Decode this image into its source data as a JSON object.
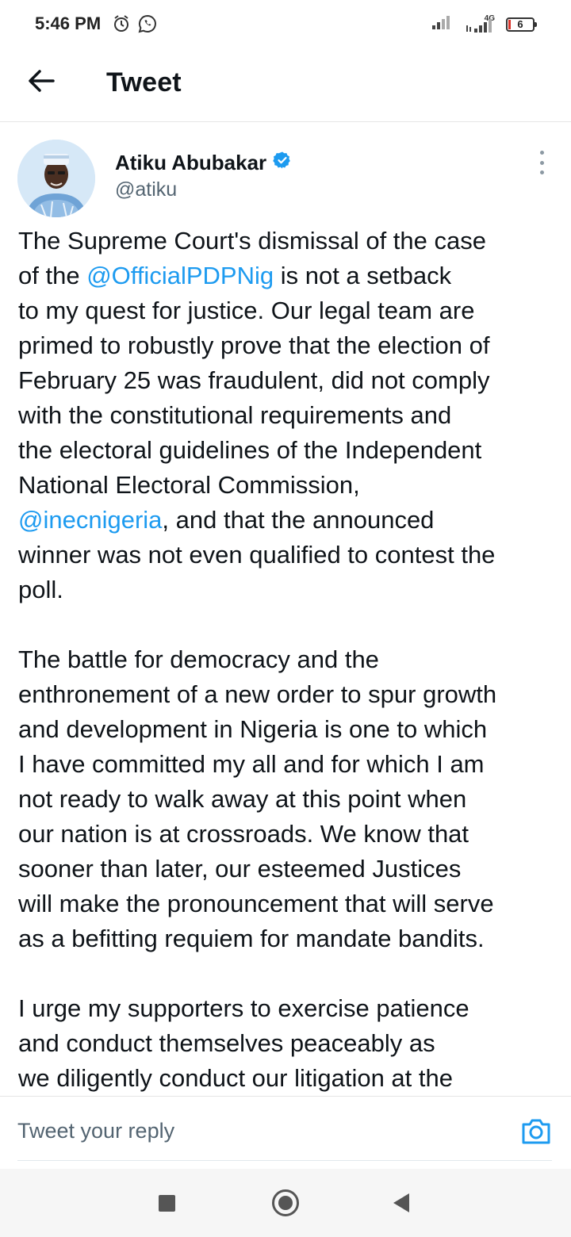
{
  "status_bar": {
    "time": "5:46 PM",
    "network": "4G",
    "battery": "6",
    "icons": [
      "alarm-icon",
      "whatsapp-icon",
      "signal-icon",
      "signal-4g-icon",
      "battery-icon"
    ]
  },
  "header": {
    "title": "Tweet",
    "back_icon": "arrow-left-icon"
  },
  "tweet": {
    "author_name": "Atiku Abubakar",
    "handle": "@atiku",
    "verified_icon": "verified-badge-icon",
    "more_icon": "more-vertical-icon",
    "paragraphs": [
      [
        [
          "The Supreme Court's dismissal of the case"
        ],
        [
          "of the ",
          {
            "mention": "@OfficialPDPNig"
          },
          " is not a setback"
        ],
        [
          "to my quest for justice. Our legal team are"
        ],
        [
          "primed to robustly prove that the election of"
        ],
        [
          "February 25 was fraudulent, did not comply"
        ],
        [
          "with the constitutional requirements and"
        ],
        [
          "the electoral guidelines of the Independent"
        ],
        [
          "National Electoral Commission,"
        ],
        [
          {
            "mention": "@inecnigeria"
          },
          ", and that the announced"
        ],
        [
          "winner was not even qualified to contest the"
        ],
        [
          "poll."
        ]
      ],
      [
        [
          "The battle for democracy and the"
        ],
        [
          "enthronement of a new order to spur growth"
        ],
        [
          "and development in Nigeria is one to which"
        ],
        [
          "I have committed my all and for which I am"
        ],
        [
          "not ready to walk away at this point when"
        ],
        [
          "our nation is at crossroads. We know that"
        ],
        [
          "sooner than later, our esteemed Justices"
        ],
        [
          "will make the pronouncement that will serve"
        ],
        [
          "as a befitting requiem for mandate bandits."
        ]
      ],
      [
        [
          "I urge my supporters to exercise patience"
        ],
        [
          "and conduct themselves peaceably as"
        ],
        [
          "we diligently conduct our litigation at the"
        ]
      ]
    ]
  },
  "reply": {
    "placeholder": "Tweet your reply",
    "camera_icon": "camera-icon"
  },
  "nav": {
    "icons": [
      "recents-square-icon",
      "home-circle-icon",
      "back-triangle-icon"
    ]
  },
  "colors": {
    "mention": "#1d9bf0",
    "text": "#0f1419",
    "muted": "#536471",
    "verified": "#1d9bf0"
  }
}
